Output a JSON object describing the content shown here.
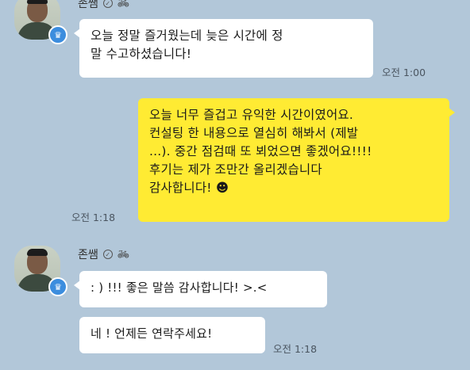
{
  "sender": {
    "name": "존쌤",
    "badge_icon": "verified-crown-icon",
    "status_icons": [
      "verified-icon",
      "bike-icon"
    ]
  },
  "messages": [
    {
      "from": "sender",
      "lines": [
        "오늘 정말 즐거웠는데 늦은 시간에 정",
        "말 수고하셨습니다!"
      ],
      "time": "오전 1:00"
    },
    {
      "from": "me",
      "lines": [
        "오늘 너무 즐겁고 유익한 시간이였어요.",
        "컨설팅 한 내용으로 열심히 해봐서 (제발",
        "...). 중간 점검때 또 뵈었으면 좋겠어요!!!!",
        "후기는 제가 조만간 올리겠습니다",
        "감사합니다! ☻"
      ],
      "time": "오전 1:18"
    },
    {
      "from": "sender",
      "lines": [
        ": ) !!! 좋은 말씀 감사합니다! >.<"
      ],
      "time": ""
    },
    {
      "from": "sender",
      "lines": [
        "네 ! 언제든 연락주세요!"
      ],
      "time": "오전 1:18"
    }
  ],
  "colors": {
    "background": "#b2c7d9",
    "my_bubble": "#ffeb33",
    "their_bubble": "#ffffff",
    "badge": "#3c8dde"
  }
}
